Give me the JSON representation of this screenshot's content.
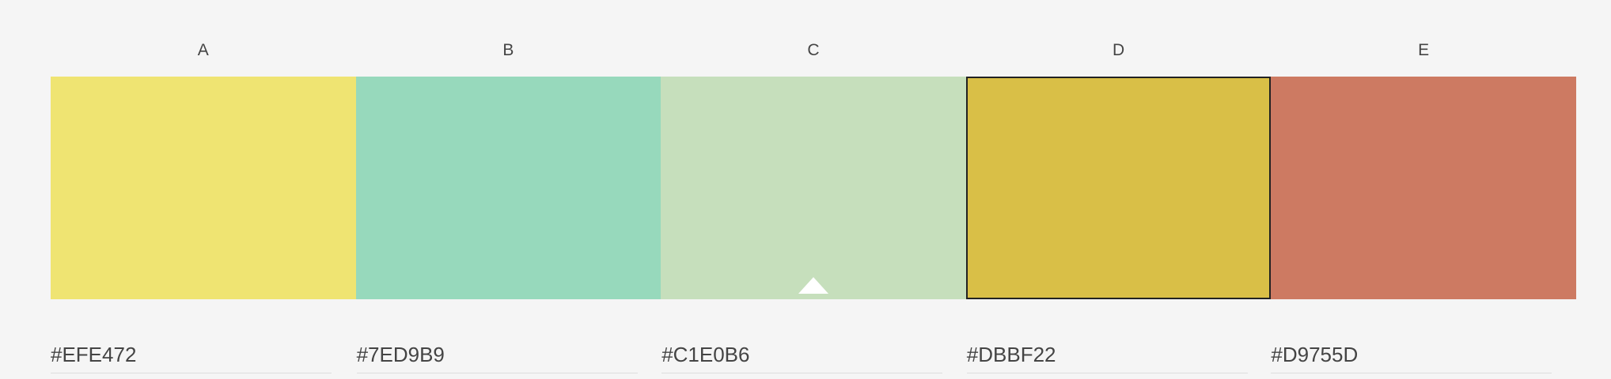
{
  "palette": {
    "columns": [
      {
        "label": "A",
        "hex": "#EFE472",
        "color": "#EFE472",
        "selected": false,
        "marker": false
      },
      {
        "label": "B",
        "hex": "#7ED9B9",
        "color": "#97D9BC",
        "selected": false,
        "marker": false
      },
      {
        "label": "C",
        "hex": "#C1E0B6",
        "color": "#C6DFBC",
        "selected": false,
        "marker": true
      },
      {
        "label": "D",
        "hex": "#DBBF22",
        "color": "#D9BF47",
        "selected": true,
        "marker": false
      },
      {
        "label": "E",
        "hex": "#D9755D",
        "color": "#CD7A62",
        "selected": false,
        "marker": false
      }
    ]
  }
}
